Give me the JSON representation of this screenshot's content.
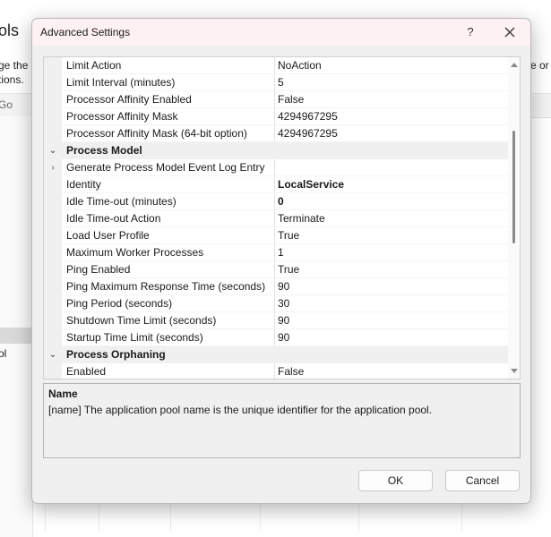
{
  "background": {
    "title_fragment": "ols",
    "text_line1": "ge the",
    "text_line2": "tions.",
    "text_right": "e or m",
    "go_label": "Go",
    "pane_item": "ol"
  },
  "dialog": {
    "title": "Advanced Settings",
    "help_label": "?",
    "rows": [
      {
        "name": "Limit Action",
        "value": "NoAction"
      },
      {
        "name": "Limit Interval (minutes)",
        "value": "5"
      },
      {
        "name": "Processor Affinity Enabled",
        "value": "False"
      },
      {
        "name": "Processor Affinity Mask",
        "value": "4294967295"
      },
      {
        "name": "Processor Affinity Mask (64-bit option)",
        "value": "4294967295"
      },
      {
        "category": true,
        "expand": "⌄",
        "name": "Process Model"
      },
      {
        "expand": "›",
        "name": "Generate Process Model Event Log Entry",
        "value": ""
      },
      {
        "name": "Identity",
        "value": "LocalService",
        "bold": true
      },
      {
        "name": "Idle Time-out (minutes)",
        "value": "0",
        "bold": true
      },
      {
        "name": "Idle Time-out Action",
        "value": "Terminate"
      },
      {
        "name": "Load User Profile",
        "value": "True"
      },
      {
        "name": "Maximum Worker Processes",
        "value": "1"
      },
      {
        "name": "Ping Enabled",
        "value": "True"
      },
      {
        "name": "Ping Maximum Response Time (seconds)",
        "value": "90"
      },
      {
        "name": "Ping Period (seconds)",
        "value": "30"
      },
      {
        "name": "Shutdown Time Limit (seconds)",
        "value": "90"
      },
      {
        "name": "Startup Time Limit (seconds)",
        "value": "90"
      },
      {
        "category": true,
        "expand": "⌄",
        "name": "Process Orphaning"
      },
      {
        "name": "Enabled",
        "value": "False"
      }
    ],
    "description": {
      "title": "Name",
      "text": "[name] The application pool name is the unique identifier for the application pool."
    },
    "ok_label": "OK",
    "cancel_label": "Cancel"
  }
}
